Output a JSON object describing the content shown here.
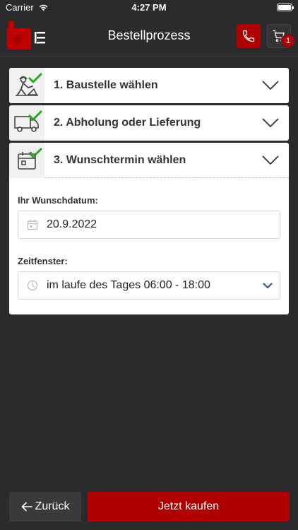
{
  "status_bar": {
    "carrier": "Carrier",
    "time": "4:27 PM"
  },
  "header": {
    "title": "Bestellprozess",
    "cart_count": "1"
  },
  "steps": [
    {
      "label": "1. Baustelle wählen",
      "icon": "construction-worker-icon",
      "completed": true
    },
    {
      "label": "2. Abholung oder Lieferung",
      "icon": "delivery-truck-icon",
      "completed": true
    },
    {
      "label": "3. Wunschtermin wählen",
      "icon": "calendar-icon",
      "completed": true
    }
  ],
  "date_section": {
    "label": "Ihr Wunschdatum:",
    "value": "20.9.2022"
  },
  "time_section": {
    "label": "Zeitfenster:",
    "value": "im laufe des Tages 06:00 - 18:00"
  },
  "footer": {
    "back_label": "Zurück",
    "buy_label": "Jetzt kaufen"
  },
  "colors": {
    "brand_red": "#b00000",
    "check_green": "#22a822",
    "background": "#2b2b2d",
    "chevron_blue": "#3a4fa0"
  }
}
